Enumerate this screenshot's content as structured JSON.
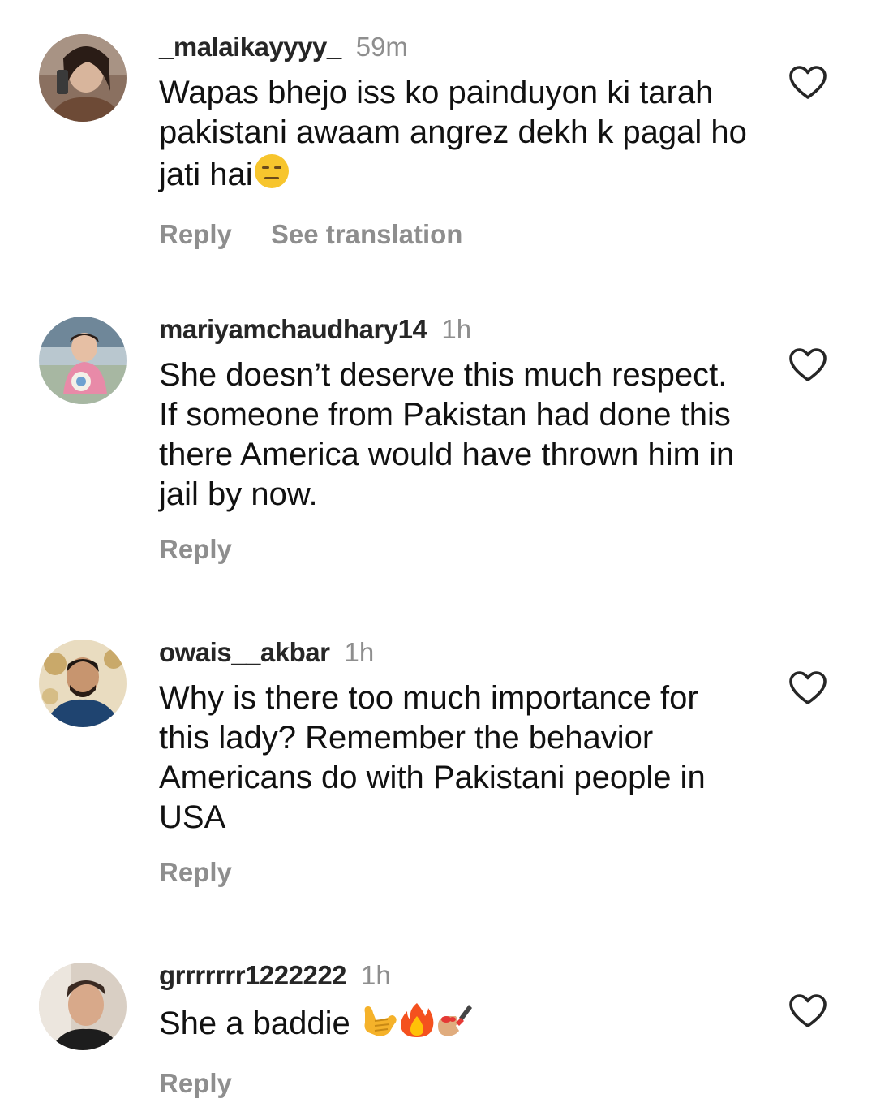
{
  "comments": [
    {
      "username": "_malaikayyyy_",
      "time": "59m",
      "text": "Wapas bhejo iss ko painduyon ki tarah pakistani awaam angrez dekh k pagal ho jati hai",
      "emoji": [
        "expressionless-face"
      ],
      "actions": [
        "Reply",
        "See translation"
      ]
    },
    {
      "username": "mariyamchaudhary14",
      "time": "1h",
      "text": "She doesn’t deserve this much respect. If someone from Pakistan had done this there America would have thrown him in jail by now.",
      "actions": [
        "Reply"
      ]
    },
    {
      "username": "owais__akbar",
      "time": "1h",
      "text": "Why is there too much importance for this lady? Remember the behavior Americans do with Pakistani people in USA",
      "actions": [
        "Reply"
      ]
    },
    {
      "username": "grrrrrrr1222222",
      "time": "1h",
      "text": "She a baddie",
      "emoji": [
        "call-me-hand",
        "fire",
        "nail-polish"
      ],
      "actions": [
        "Reply"
      ]
    }
  ],
  "icons": {
    "like": "heart-outline-icon"
  },
  "colors": {
    "username": "#262626",
    "secondary_text": "#8e8e8e",
    "body_text": "#111111",
    "background": "#ffffff"
  }
}
